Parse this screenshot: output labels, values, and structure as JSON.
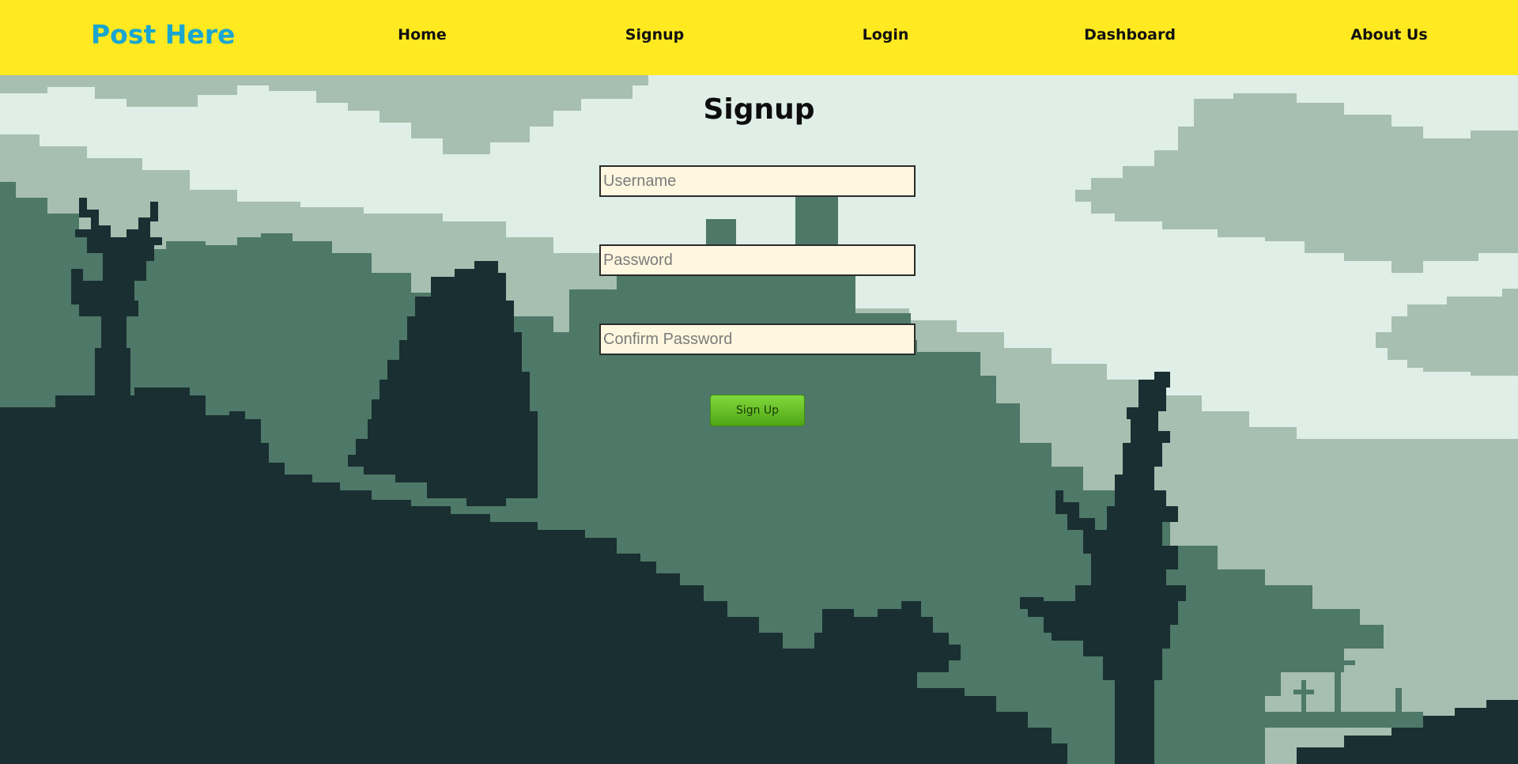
{
  "navbar": {
    "brand": "Post Here",
    "links": [
      "Home",
      "Signup",
      "Login",
      "Dashboard",
      "About Us"
    ]
  },
  "form": {
    "title": "Signup",
    "username_placeholder": "Username",
    "username_value": "",
    "password_placeholder": "Password",
    "password_value": "",
    "confirm_placeholder": "Confirm Password",
    "confirm_value": "",
    "submit_label": "Sign Up"
  },
  "colors": {
    "navbar": "#ffe920",
    "brand": "#1aa6cf",
    "input_bg": "#fff7df",
    "button": "#5fb521",
    "sky": "#dfeee6",
    "cloud": "#a6bfb0",
    "hill": "#4e7868",
    "dark": "#1a2f32"
  }
}
